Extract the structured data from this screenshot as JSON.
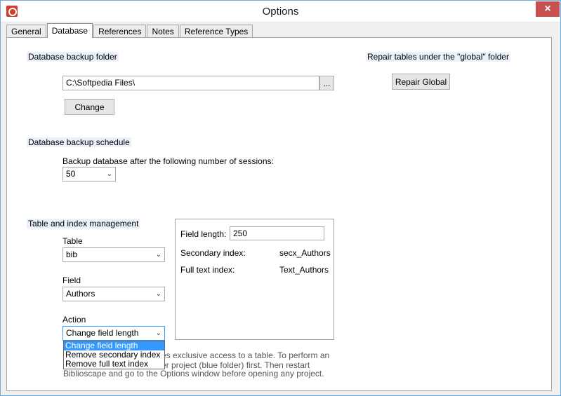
{
  "window": {
    "title": "Options",
    "close_glyph": "×"
  },
  "tabs": [
    {
      "label": "General"
    },
    {
      "label": "Database"
    },
    {
      "label": "References"
    },
    {
      "label": "Notes"
    },
    {
      "label": "Reference Types"
    }
  ],
  "backup_folder": {
    "section_label": "Database backup folder",
    "path_value": "C:\\Softpedia Files\\",
    "browse_label": "...",
    "change_label": "Change"
  },
  "repair": {
    "section_label": "Repair tables under the \"global\" folder",
    "button_label": "Repair Global"
  },
  "backup_schedule": {
    "section_label": "Database backup schedule",
    "prompt": "Backup database after the following number of sessions:",
    "sessions_value": "50"
  },
  "table_mgmt": {
    "section_label": "Table and index management",
    "table_label": "Table",
    "table_value": "bib",
    "field_label": "Field",
    "field_value": "Authors",
    "action_label": "Action",
    "action_value": "Change field length",
    "action_options": [
      "Change field length",
      "Remove secondary index",
      "Remove full text index"
    ],
    "info": {
      "field_length_label": "Field length:",
      "field_length_value": "250",
      "secondary_index_label": "Secondary index:",
      "secondary_index_value": "secx_Authors",
      "full_text_index_label": "Full text index:",
      "full_text_index_value": "Text_Authors"
    },
    "note_line1": "es exclusive access to a table. To perform an",
    "note_line2": "er project (blue folder) first. Then restart",
    "note_line3": "Biblioscape and go to the Options window before opening any project."
  },
  "colors": {
    "accent": "#3399ff",
    "close": "#c75050",
    "app_icon": "#d33b2c"
  }
}
